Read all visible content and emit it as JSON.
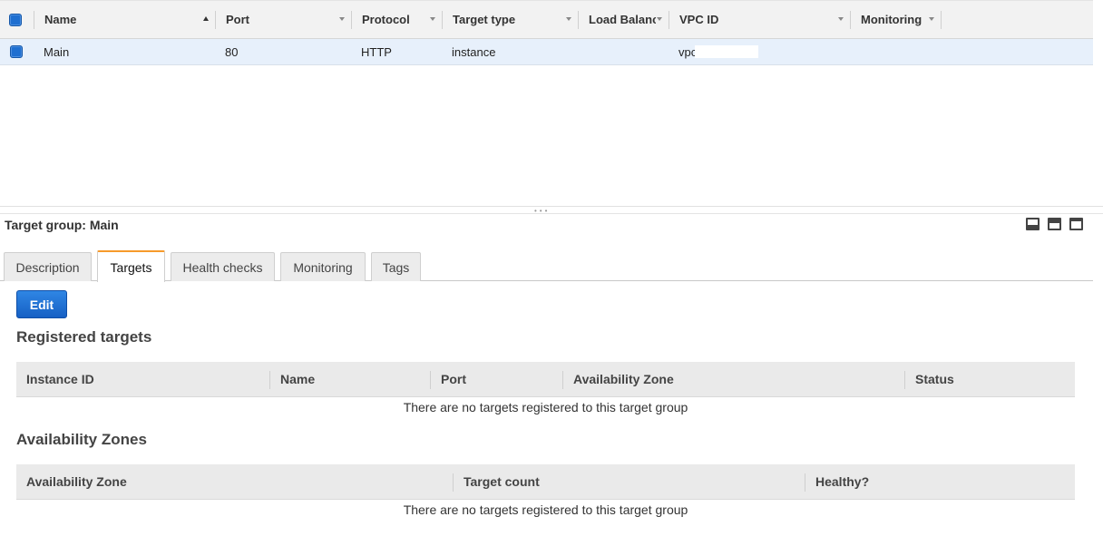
{
  "grid": {
    "columns": [
      {
        "label": "Name"
      },
      {
        "label": "Port"
      },
      {
        "label": "Protocol"
      },
      {
        "label": "Target type"
      },
      {
        "label": "Load Balanc"
      },
      {
        "label": "VPC ID"
      },
      {
        "label": "Monitoring"
      }
    ],
    "rows": [
      {
        "name": "Main",
        "port": "80",
        "protocol": "HTTP",
        "target_type": "instance",
        "load_balancer": "",
        "vpc_id": "vpc",
        "monitoring": ""
      }
    ]
  },
  "detail": {
    "title": "Target group: Main",
    "tabs": [
      {
        "label": "Description"
      },
      {
        "label": "Targets"
      },
      {
        "label": "Health checks"
      },
      {
        "label": "Monitoring"
      },
      {
        "label": "Tags"
      }
    ],
    "active_tab": "Targets",
    "edit_label": "Edit",
    "registered": {
      "title": "Registered targets",
      "columns": [
        "Instance ID",
        "Name",
        "Port",
        "Availability Zone",
        "Status"
      ],
      "empty_text": "There are no targets registered to this target group"
    },
    "zones": {
      "title": "Availability Zones",
      "columns": [
        "Availability Zone",
        "Target count",
        "Healthy?"
      ],
      "empty_text": "There are no targets registered to this target group"
    }
  },
  "colors": {
    "selected_row": "#e7f0fb",
    "checkbox": "#1f6fd0",
    "active_tab_accent": "#f79a2b",
    "primary_button": "#1f6fd0"
  },
  "icons": {
    "panel_controls": [
      "panel-minimize-icon",
      "panel-half-icon",
      "panel-maximize-icon"
    ]
  }
}
